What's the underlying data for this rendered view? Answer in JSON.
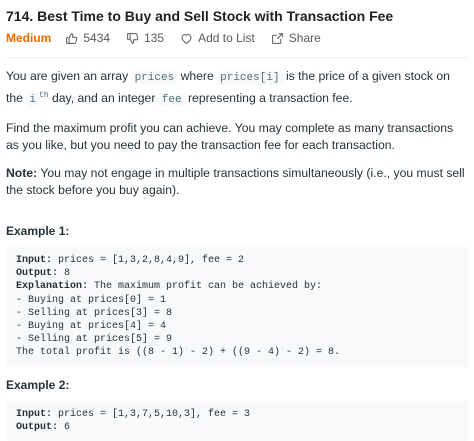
{
  "problem": {
    "title": "714. Best Time to Buy and Sell Stock with Transaction Fee",
    "difficulty": "Medium",
    "likes": "5434",
    "dislikes": "135",
    "add_to_list": "Add to List",
    "share": "Share"
  },
  "description": {
    "p1_a": "You are given an array ",
    "p1_code1": "prices",
    "p1_b": " where ",
    "p1_code2": "prices[i]",
    "p1_c": " is the price of a given stock on the ",
    "p1_sup": "i",
    "p1_sup_th": "th",
    "p1_d": " day, and an integer ",
    "p1_code3": "fee",
    "p1_e": " representing a transaction fee.",
    "p2": "Find the maximum profit you can achieve. You may complete as many transactions as you like, but you need to pay the transaction fee for each transaction.",
    "note_label": "Note:",
    "note_text": " You may not engage in multiple transactions simultaneously (i.e., you must sell the stock before you buy again)."
  },
  "examples": [
    {
      "title": "Example 1:",
      "input_label": "Input:",
      "input": " prices = [1,3,2,8,4,9], fee = 2",
      "output_label": "Output:",
      "output": " 8",
      "explanation_label": "Explanation:",
      "explanation": " The maximum profit can be achieved by:",
      "lines": [
        "- Buying at prices[0] = 1",
        "- Selling at prices[3] = 8",
        "- Buying at prices[4] = 4",
        "- Selling at prices[5] = 9",
        "The total profit is ((8 - 1) - 2) + ((9 - 4) - 2) = 8."
      ]
    },
    {
      "title": "Example 2:",
      "input_label": "Input:",
      "input": " prices = [1,3,7,5,10,3], fee = 3",
      "output_label": "Output:",
      "output": " 6"
    }
  ]
}
